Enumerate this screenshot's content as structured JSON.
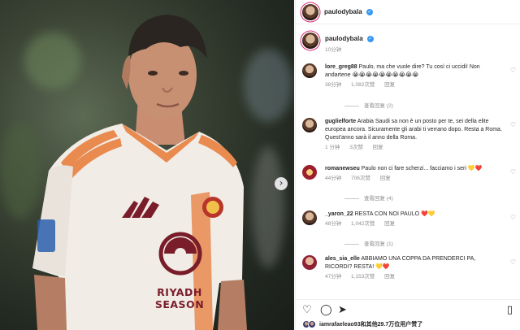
{
  "post": {
    "username": "paulodybala",
    "caption_time": "10分钟"
  },
  "comments": [
    {
      "user": "lore_greg88",
      "text": "Paulo, ma che vuole dire? Tu così ci uccidi! Non andartene 😭😭😭😭😭😭😭😭😭😭",
      "time": "38分钟",
      "likes": "1,082次赞",
      "reply": "回复",
      "replies": "查看回复 (2)"
    },
    {
      "user": "guglielforte",
      "text": "Arabia Saudi sa non è un posto per te, sei della elite europea ancora. Sicuramente gli arabi ti verrano dopo. Resta a Roma. Quest'anno sarà il anno della Roma.",
      "time": "1 分钟",
      "likes": "3次赞",
      "reply": "回复"
    },
    {
      "user": "romanewseu",
      "text": "Paulo non ci fare scherzi... facciamo i seri 💛❤️",
      "time": "44分钟",
      "likes": "706次赞",
      "reply": "回复",
      "replies": "查看回复 (4)"
    },
    {
      "user": "_yaron_22",
      "text": "RESTA CON NOI PAULO ❤️💛",
      "time": "48分钟",
      "likes": "1,042次赞",
      "reply": "回复",
      "replies": "查看回复 (1)"
    },
    {
      "user": "ales_sia_elle",
      "text": "ABBIAMO UNA COPPA DA PRENDERCI PA, RICORDI? RESTA! 💛❤️",
      "time": "47分钟",
      "likes": "1,153次赞",
      "reply": "回复"
    }
  ],
  "liked_by": {
    "text": "iamrafaeleao93和其他29.7万位用户赞了"
  },
  "jersey": {
    "sponsor": "RIYADH SEASON"
  },
  "icons": {
    "verified": "verified-badge-icon",
    "heart": "heart-icon",
    "like": "heart-outline-icon",
    "comment": "comment-bubble-icon",
    "share": "paper-plane-icon",
    "save": "bookmark-icon",
    "next": "chevron-right-icon"
  },
  "colors": {
    "verified": "#3897f0",
    "jersey_stripe": "#e98a4f",
    "sponsor": "#7a1d2a"
  }
}
